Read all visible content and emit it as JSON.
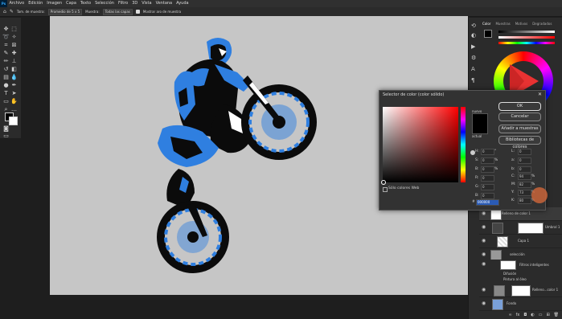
{
  "menu": {
    "logo": "Ps",
    "items": [
      "Archivo",
      "Edición",
      "Imagen",
      "Capa",
      "Texto",
      "Selección",
      "Filtro",
      "3D",
      "Vista",
      "Ventana",
      "Ayuda"
    ]
  },
  "options_bar": {
    "sample_size_label": "Tam. de muestra:",
    "sample_size_value": "Promedio de 5 x 5",
    "sample_label": "Muestra:",
    "sample_value": "Todas las capas",
    "show_ring_label": "Mostrar aro de muestra"
  },
  "panels": {
    "tabs": [
      "Color",
      "Muestras",
      "Motivos",
      "Degradados"
    ]
  },
  "dialog": {
    "title": "Selector de color (color sólido)",
    "ok": "OK",
    "cancel": "Cancelar",
    "add_swatch": "Añadir a muestras",
    "libraries": "Bibliotecas de colores",
    "new_label": "nuevo",
    "current_label": "actual",
    "web_only": "Sólo colores Web",
    "fields": {
      "H": {
        "label": "H:",
        "value": "0",
        "unit": "°"
      },
      "S": {
        "label": "S:",
        "value": "0",
        "unit": "%"
      },
      "B": {
        "label": "B:",
        "value": "0",
        "unit": "%"
      },
      "R": {
        "label": "R:",
        "value": "0"
      },
      "G": {
        "label": "G:",
        "value": "0"
      },
      "Bl": {
        "label": "B:",
        "value": "0"
      },
      "L": {
        "label": "L:",
        "value": "0"
      },
      "a": {
        "label": "a:",
        "value": "0"
      },
      "b": {
        "label": "b:",
        "value": "0"
      },
      "C": {
        "label": "C:",
        "value": "94",
        "unit": "%"
      },
      "M": {
        "label": "M:",
        "value": "82",
        "unit": "%"
      },
      "Y": {
        "label": "Y:",
        "value": "73",
        "unit": "%"
      },
      "K": {
        "label": "K:",
        "value": "80",
        "unit": "%"
      }
    },
    "hex_label": "#",
    "hex_value": "000000"
  },
  "layers": [
    {
      "name": "Relleno de color 1"
    },
    {
      "name": "Umbral 1"
    },
    {
      "name": "Capa 1"
    },
    {
      "name": "selección"
    },
    {
      "name": "Filtros inteligentes"
    },
    {
      "name": "Difusión"
    },
    {
      "name": "Pintura al óleo"
    },
    {
      "name": "Relleno...color 1"
    },
    {
      "name": "Fondo"
    }
  ],
  "colors": {
    "accent_blue": "#2f7fe0",
    "cursor_orange": "#c8643a",
    "selected_hex_bg": "#2a5bb5"
  }
}
